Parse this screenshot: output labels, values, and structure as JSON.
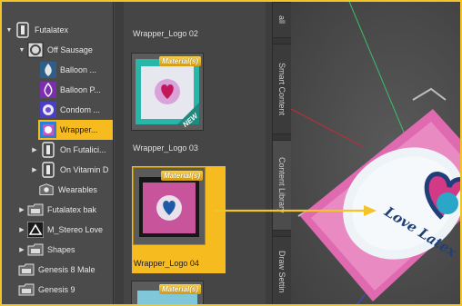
{
  "tree": {
    "items": [
      {
        "label": "Futalatex",
        "arrow": "▼",
        "icon": "figure-icon"
      },
      {
        "label": "Off Sausage",
        "arrow": "▼",
        "icon": "package-icon"
      },
      {
        "label": "Balloon ...",
        "arrow": "",
        "icon": "balloon-icon"
      },
      {
        "label": "Balloon P...",
        "arrow": "",
        "icon": "balloon-outline-icon"
      },
      {
        "label": "Condom ...",
        "arrow": "",
        "icon": "condom-icon"
      },
      {
        "label": "Wrapper...",
        "arrow": "",
        "icon": "wrapper-icon"
      },
      {
        "label": "On Futalici...",
        "arrow": "▶",
        "icon": "figure-icon"
      },
      {
        "label": "On Vitamin D",
        "arrow": "▶",
        "icon": "figure-icon"
      },
      {
        "label": "Wearables",
        "arrow": "",
        "icon": "wearables-icon"
      },
      {
        "label": "Futalatex bak",
        "arrow": "▶",
        "icon": "folder-icon"
      },
      {
        "label": "M_Stereo Love",
        "arrow": "▶",
        "icon": "logo-icon"
      },
      {
        "label": "Shapes",
        "arrow": "▶",
        "icon": "folder-icon"
      },
      {
        "label": "Genesis 8 Male",
        "arrow": "",
        "icon": "folder-icon"
      },
      {
        "label": "Genesis 9",
        "arrow": "",
        "icon": "folder-icon"
      }
    ]
  },
  "thumbs": {
    "items": [
      {
        "caption": "Wrapper_Logo 02",
        "badge": "Material(s)"
      },
      {
        "caption": "Wrapper_Logo 03",
        "badge": "Material(s)"
      },
      {
        "caption": "Wrapper_Logo 04",
        "badge": "Material(s)"
      },
      {
        "caption": "",
        "badge": "Material(s)"
      }
    ],
    "new_badge": "NEW"
  },
  "tabs": {
    "top": "all",
    "smart": "Smart Content",
    "library": "Content Library",
    "draw": "Draw Settin"
  },
  "viewport": {
    "logo_text": "Love Latex"
  },
  "colors": {
    "accent": "#f5bb1f",
    "arrow": "#f3c32a"
  }
}
